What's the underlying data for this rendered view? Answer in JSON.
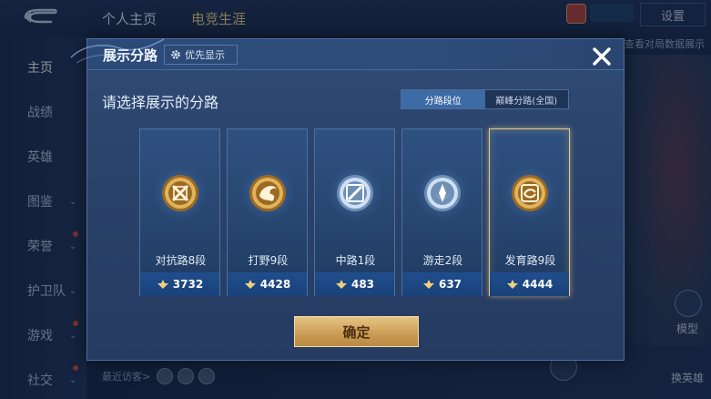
{
  "background": {
    "top_tabs": [
      "个人主页",
      "电竞生涯"
    ],
    "settings_label": "设置",
    "sidebar": [
      {
        "label": "主页",
        "active": true,
        "chevron": false,
        "dot": false
      },
      {
        "label": "战绩",
        "active": false,
        "chevron": false,
        "dot": false
      },
      {
        "label": "英雄",
        "active": false,
        "chevron": false,
        "dot": false
      },
      {
        "label": "图鉴",
        "active": false,
        "chevron": true,
        "dot": false
      },
      {
        "label": "荣誉",
        "active": false,
        "chevron": true,
        "dot": true
      },
      {
        "label": "护卫队",
        "active": false,
        "chevron": true,
        "dot": false
      },
      {
        "label": "游戏",
        "active": false,
        "chevron": true,
        "dot": true
      },
      {
        "label": "社交",
        "active": false,
        "chevron": true,
        "dot": true
      }
    ],
    "recent_visitors_label": "最近访客>",
    "right_link": "查看对局数据展示",
    "right_labels": [
      "模型",
      "换英雄"
    ]
  },
  "modal": {
    "title": "展示分路",
    "priority_button": "优先显示",
    "close_icon": "close-icon",
    "subtitle": "请选择展示的分路",
    "tabs": [
      {
        "label": "分路段位",
        "active": true
      },
      {
        "label": "巅峰分路(全国)",
        "active": false
      }
    ],
    "cards": [
      {
        "name": "对抗路8段",
        "score": "3732",
        "icon": "sword-badge-icon",
        "selected": false
      },
      {
        "name": "打野9段",
        "score": "4428",
        "icon": "dragon-badge-icon",
        "selected": false
      },
      {
        "name": "中路1段",
        "score": "483",
        "icon": "staff-badge-icon",
        "selected": false
      },
      {
        "name": "游走2段",
        "score": "637",
        "icon": "wing-badge-icon",
        "selected": false
      },
      {
        "name": "发育路9段",
        "score": "4444",
        "icon": "arrow-badge-icon",
        "selected": true
      }
    ],
    "confirm_label": "确定"
  },
  "colors": {
    "gold": "#e7c98a",
    "active_tab": "#3d6ba5",
    "panel": "#2a4169",
    "confirm": "#d5ad68"
  }
}
